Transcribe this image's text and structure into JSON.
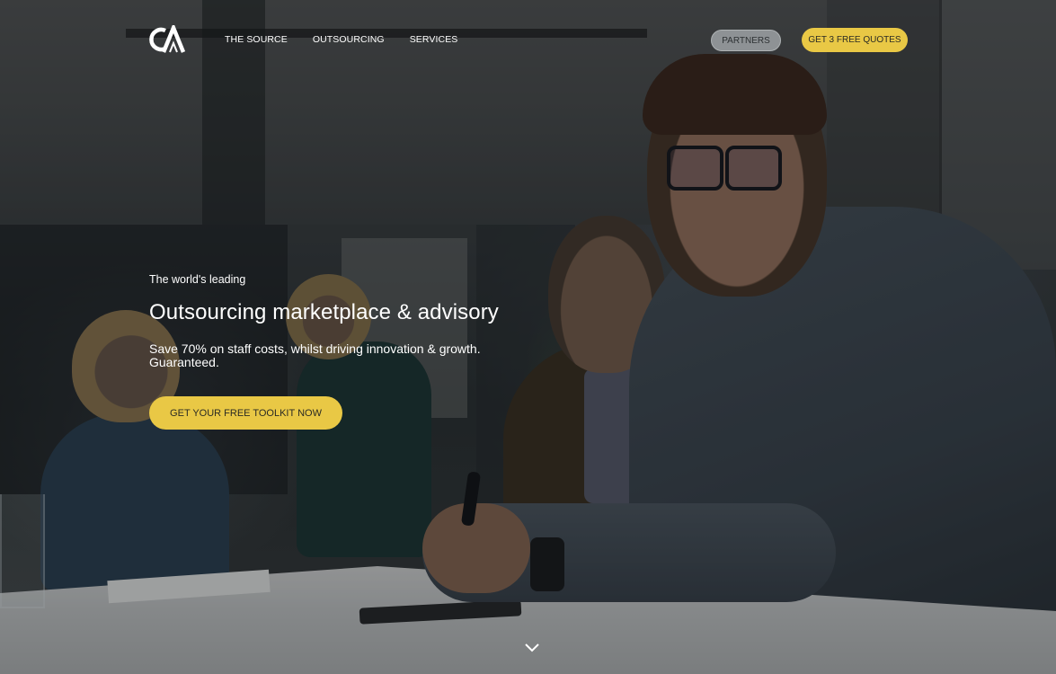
{
  "header": {
    "logo_text": "CA",
    "nav": [
      {
        "label": "THE SOURCE"
      },
      {
        "label": "OUTSOURCING"
      },
      {
        "label": "SERVICES"
      }
    ],
    "partners_label": "PARTNERS",
    "quotes_label": "GET 3 FREE QUOTES"
  },
  "hero": {
    "eyebrow": "The world's leading",
    "title": "Outsourcing marketplace & advisory",
    "subtitle": "Save 70% on staff costs, whilst driving innovation & growth. Guaranteed.",
    "cta_label": "GET YOUR FREE TOOLKIT NOW",
    "scroll_icon": "chevron-down-icon"
  },
  "colors": {
    "accent": "#e9c845",
    "partners_button": "#8e9295",
    "text": "#ffffff"
  }
}
